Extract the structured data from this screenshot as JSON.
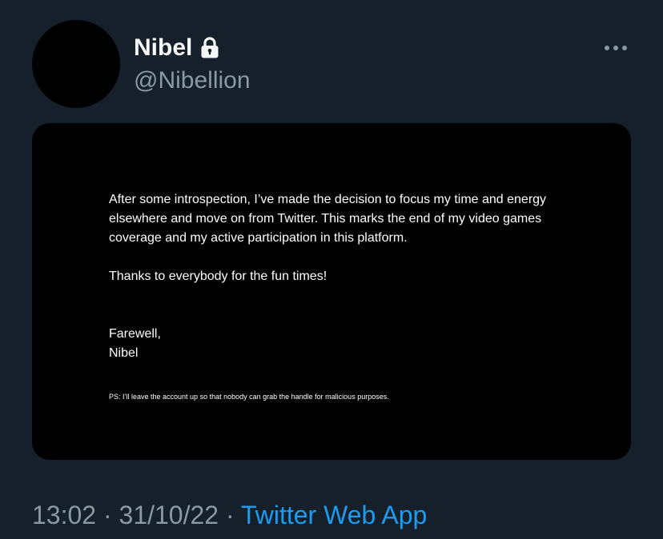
{
  "author": {
    "display_name": "Nibel",
    "handle": "@Nibellion",
    "protected_icon": "lock-icon"
  },
  "menu": {
    "more_icon": "more-horizontal-icon"
  },
  "media": {
    "paragraph_1": "After some introspection, I’ve made the decision to focus my time and energy elsewhere and move on from Twitter. This marks the end of my video games coverage and my active participation in this platform.",
    "paragraph_2": "Thanks to everybody for the fun times!",
    "closing_line_1": "Farewell,",
    "closing_line_2": "Nibel",
    "ps": "PS: I’ll leave the account up so that nobody can grab the handle for malicious purposes."
  },
  "meta": {
    "time": "13:02",
    "separator": "·",
    "date": "31/10/22",
    "source": "Twitter Web App"
  },
  "colors": {
    "background": "#15202b",
    "primary_text": "#f7f9f9",
    "secondary_text": "#8b98a5",
    "link": "#1d9bf0",
    "media_background": "#000000"
  }
}
